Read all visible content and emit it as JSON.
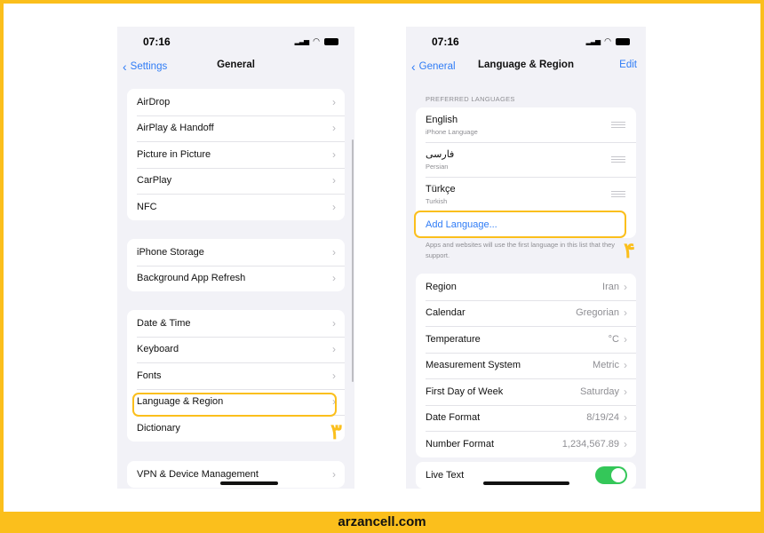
{
  "left": {
    "time": "07:16",
    "back": "Settings",
    "title": "General",
    "groups": [
      [
        "AirDrop",
        "AirPlay & Handoff",
        "Picture in Picture",
        "CarPlay",
        "NFC"
      ],
      [
        "iPhone Storage",
        "Background App Refresh"
      ],
      [
        "Date & Time",
        "Keyboard",
        "Fonts",
        "Language & Region",
        "Dictionary"
      ],
      [
        "VPN & Device Management"
      ]
    ],
    "step": "۳"
  },
  "right": {
    "time": "07:16",
    "back": "General",
    "title": "Language & Region",
    "edit": "Edit",
    "pref_header": "PREFERRED LANGUAGES",
    "languages": [
      {
        "name": "English",
        "sub": "iPhone Language"
      },
      {
        "name": "فارسی",
        "sub": "Persian"
      },
      {
        "name": "Türkçe",
        "sub": "Turkish"
      }
    ],
    "add": "Add Language...",
    "note": "Apps and websites will use the first language in this list that they support.",
    "settings": [
      {
        "label": "Region",
        "value": "Iran"
      },
      {
        "label": "Calendar",
        "value": "Gregorian"
      },
      {
        "label": "Temperature",
        "value": "°C"
      },
      {
        "label": "Measurement System",
        "value": "Metric"
      },
      {
        "label": "First Day of Week",
        "value": "Saturday"
      },
      {
        "label": "Date Format",
        "value": "8/19/24"
      },
      {
        "label": "Number Format",
        "value": "1,234,567.89"
      }
    ],
    "live_text": "Live Text",
    "live_text_on": true,
    "step": "۴"
  },
  "footer": "arzancell.com",
  "colors": {
    "accent": "#fbbf1c",
    "link": "#2f7cf6",
    "toggle": "#34c759"
  }
}
